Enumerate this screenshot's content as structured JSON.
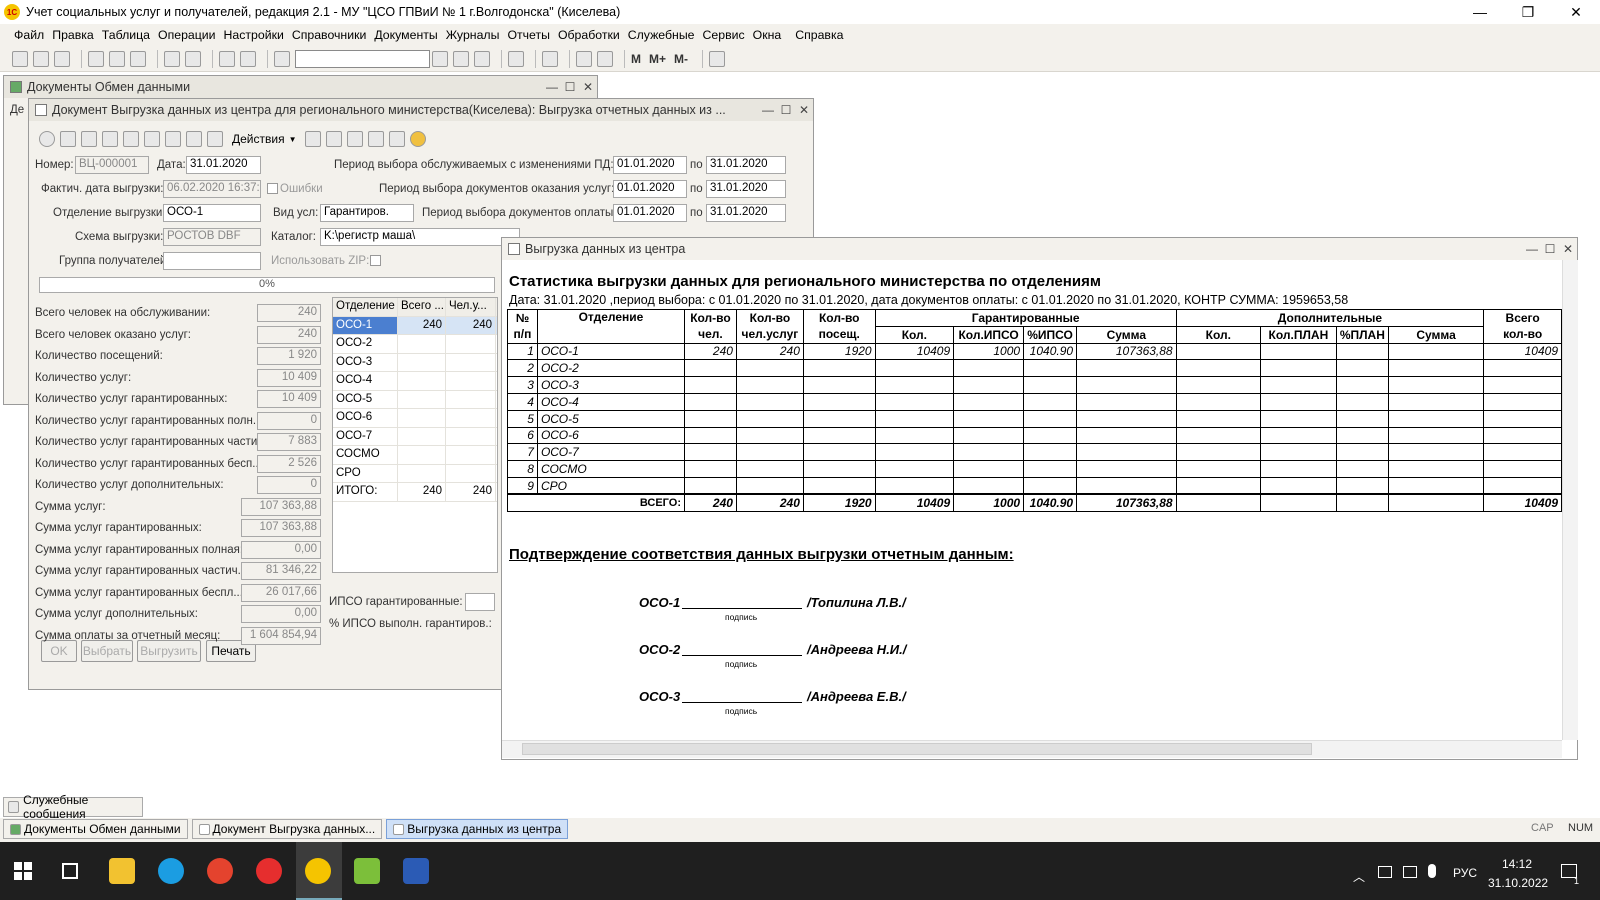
{
  "app": {
    "title": "Учет социальных услуг и получателей, редакция 2.1 - МУ \"ЦСО ГПВиИ № 1 г.Волгодонска\" (Киселева)",
    "logo": "1С"
  },
  "menu": [
    "Файл",
    "Правка",
    "Таблица",
    "Операции",
    "Настройки",
    "Справочники",
    "Документы",
    "Журналы",
    "Отчеты",
    "Обработки",
    "Служебные",
    "Сервис",
    "Окна",
    "Справка"
  ],
  "toolbar": {
    "m": "M",
    "mplus": "M+",
    "mminus": "M-"
  },
  "win_docs": {
    "title": "Документы Обмен данными",
    "tab": "Де"
  },
  "doc": {
    "title": "Документ Выгрузка данных из центра для регионального министерства(Киселева): Выгрузка отчетных данных из ...",
    "actions": "Действия",
    "number_label": "Номер:",
    "number": "ВЦ-000001",
    "date_label": "Дата:",
    "date": "31.01.2020",
    "period_pd_label": "Период выбора обслуживаемых с изменениями  ПД: с",
    "period_pd_from": "01.01.2020",
    "period_pd_to": "31.01.2020",
    "fact_label": "Фактич. дата выгрузки:",
    "fact": "06.02.2020 16:37:5",
    "errors_label": "Ошибки",
    "period_docs_label": "Период выбора документов оказания услуг: с",
    "period_docs_from": "01.01.2020",
    "period_docs_to": "31.01.2020",
    "po": "по",
    "dept_label": "Отделение выгрузки:",
    "dept": "ОСО-1",
    "vid_label": "Вид усл:",
    "vid": "Гарантиров.",
    "period_pay_label": "Период выбора документов оплаты с:",
    "period_pay_from": "01.01.2020",
    "period_pay_to": "31.01.2020",
    "scheme_label": "Схема выгрузки:",
    "scheme": "РОСТОВ DBF",
    "catalog_label": "Каталог:",
    "catalog": "K:\\регистр маша\\",
    "group_label": "Группа получателей:",
    "zip_label": "Использовать ZIP:",
    "progress": "0%",
    "stats": [
      {
        "label": "Всего человек на обслуживании:",
        "value": "240"
      },
      {
        "label": "Всего человек оказано услуг:",
        "value": "240"
      },
      {
        "label": "Количество посещений:",
        "value": "1 920"
      },
      {
        "label": "Количество услуг:",
        "value": "10 409"
      },
      {
        "label": "Количество услуг гарантированных:",
        "value": "10 409"
      },
      {
        "label": "Количество услуг гарантированных полн...",
        "value": "0"
      },
      {
        "label": "Количество услуг гарантированных части...",
        "value": "7 883"
      },
      {
        "label": "Количество услуг гарантированных бесп...",
        "value": "2 526"
      },
      {
        "label": "Количество услуг дополнительных:",
        "value": "0"
      },
      {
        "label": "Сумма услуг:",
        "value": "107 363,88"
      },
      {
        "label": "Сумма услуг гарантированных:",
        "value": "107 363,88"
      },
      {
        "label": "Сумма услуг гарантированных полная:",
        "value": "0,00"
      },
      {
        "label": "Сумма услуг гарантированных частич...",
        "value": "81 346,22"
      },
      {
        "label": "Сумма услуг гарантированных беспл...",
        "value": "26 017,66"
      },
      {
        "label": "Сумма услуг дополнительных:",
        "value": "0,00"
      },
      {
        "label": "Сумма оплаты за отчетный месяц:",
        "value": "1 604 854,94"
      }
    ],
    "grid_headers": [
      "Отделение",
      "Всего ...",
      "Чел.у..."
    ],
    "grid_rows": [
      {
        "name": "ОСО-1",
        "a": "240",
        "b": "240"
      },
      {
        "name": "ОСО-2",
        "a": "",
        "b": ""
      },
      {
        "name": "ОСО-3",
        "a": "",
        "b": ""
      },
      {
        "name": "ОСО-4",
        "a": "",
        "b": ""
      },
      {
        "name": "ОСО-5",
        "a": "",
        "b": ""
      },
      {
        "name": "ОСО-6",
        "a": "",
        "b": ""
      },
      {
        "name": "ОСО-7",
        "a": "",
        "b": ""
      },
      {
        "name": "СОСМО",
        "a": "",
        "b": ""
      },
      {
        "name": "СРО",
        "a": "",
        "b": ""
      },
      {
        "name": "ИТОГО:",
        "a": "240",
        "b": "240"
      }
    ],
    "ipso_label": "ИПСО гарантированные:",
    "ipso_pct_label": "% ИПСО выполн. гарантиров.:",
    "buttons": {
      "ok": "OK",
      "select": "Выбрать",
      "export": "Выгрузить",
      "print": "Печать"
    }
  },
  "report": {
    "title": "Выгрузка данных из центра",
    "heading": "Статистика выгрузки данных для регионального министерства по отделениям",
    "subtitle": "Дата: 31.01.2020 ,период выбора: с 01.01.2020 по 31.01.2020, дата документов оплаты: с 01.01.2020 по 31.01.2020, КОНТР СУММА: 1959653,58",
    "h_num": "№",
    "h_np": "п/п",
    "h_dept": "Отделение",
    "h_kv1": "Кол-во",
    "h_chel": "чел.",
    "h_kv2": "Кол-во",
    "h_chelu": "чел.услуг",
    "h_kv3": "Кол-во",
    "h_pos": "посещ.",
    "h_gar": "Гарантированные",
    "h_dop": "Дополнительные",
    "h_total": "Всего",
    "h_totalkv": "кол-во",
    "sub_gar": [
      "Кол.",
      "Кол.ИПСО",
      "%ИПСО",
      "Сумма"
    ],
    "sub_dop": [
      "Кол.",
      "Кол.ПЛАН",
      "%ПЛАН",
      "Сумма"
    ],
    "rows": [
      {
        "n": "1",
        "dept": "ОСО-1",
        "chel": "240",
        "chelu": "240",
        "pos": "1920",
        "gk": "10409",
        "gi": "1000",
        "gp": "1040.90",
        "gs": "107363,88",
        "tot": "10409"
      },
      {
        "n": "2",
        "dept": "ОСО-2"
      },
      {
        "n": "3",
        "dept": "ОСО-3"
      },
      {
        "n": "4",
        "dept": "ОСО-4"
      },
      {
        "n": "5",
        "dept": "ОСО-5"
      },
      {
        "n": "6",
        "dept": "ОСО-6"
      },
      {
        "n": "7",
        "dept": "ОСО-7"
      },
      {
        "n": "8",
        "dept": "СОСМО"
      },
      {
        "n": "9",
        "dept": "СРО"
      }
    ],
    "totals": {
      "label": "ВСЕГО:",
      "chel": "240",
      "chelu": "240",
      "pos": "1920",
      "gk": "10409",
      "gi": "1000",
      "gp": "1040.90",
      "gs": "107363,88",
      "tot": "10409"
    },
    "confirm": "Подтверждение соответствия данных выгрузки отчетным данным:",
    "signatures": [
      {
        "dept": "ОСО-1",
        "name": "/Топилина Л.В./",
        "caption": "подпись"
      },
      {
        "dept": "ОСО-2",
        "name": "/Андреева Н.И./",
        "caption": "подпись"
      },
      {
        "dept": "ОСО-3",
        "name": "/Андреева Е.В./",
        "caption": "подпись"
      }
    ]
  },
  "service_messages": "Служебные сообщения",
  "tabs": [
    "Документы Обмен данными",
    "Документ Выгрузка данных...",
    "Выгрузка данных из центра"
  ],
  "status": {
    "cap": "CAP",
    "num": "NUM"
  },
  "system": {
    "lang": "РУС",
    "time": "14:12",
    "date": "31.10.2022",
    "notif": "1"
  }
}
